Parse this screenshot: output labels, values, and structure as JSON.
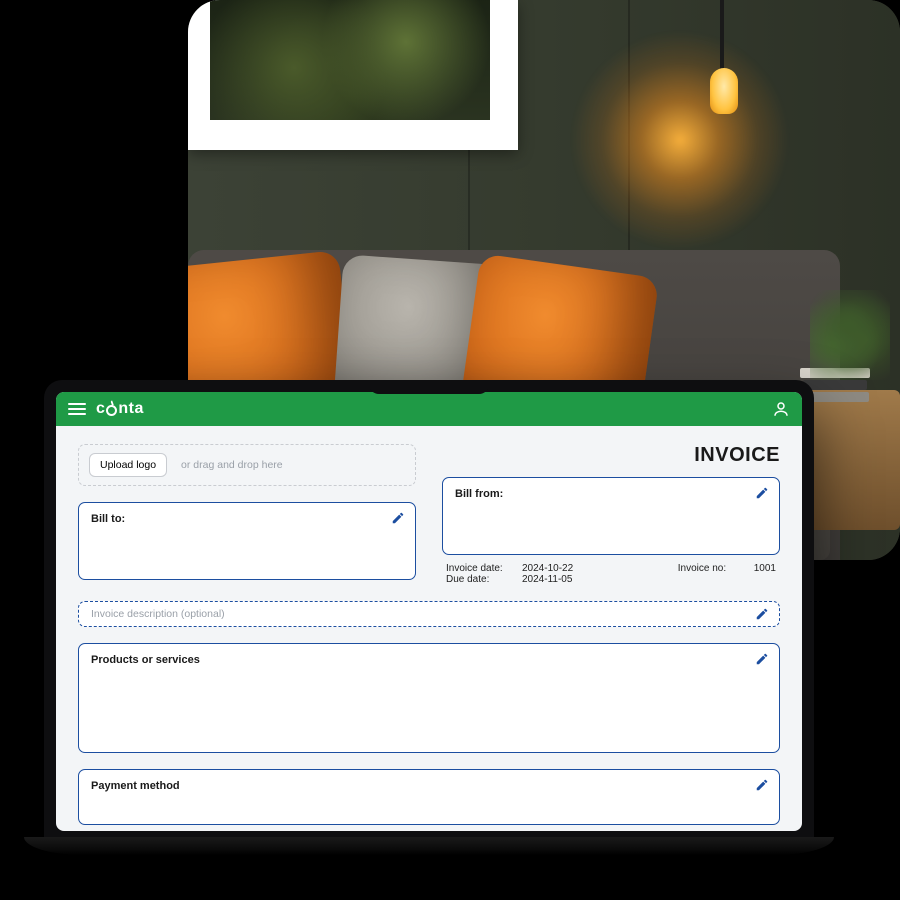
{
  "brand": {
    "name_pre": "c",
    "name_post": "nta"
  },
  "header": {
    "invoice_title": "INVOICE"
  },
  "upload": {
    "button": "Upload logo",
    "hint": "or drag and drop here"
  },
  "bill_to": {
    "label": "Bill to:"
  },
  "bill_from": {
    "label": "Bill from:"
  },
  "meta": {
    "invoice_date_label": "Invoice date:",
    "invoice_date_value": "2024-10-22",
    "due_date_label": "Due date:",
    "due_date_value": "2024-11-05",
    "invoice_no_label": "Invoice no:",
    "invoice_no_value": "1001"
  },
  "description": {
    "placeholder": "Invoice description (optional)"
  },
  "products": {
    "label": "Products or services"
  },
  "payment": {
    "label": "Payment method"
  }
}
